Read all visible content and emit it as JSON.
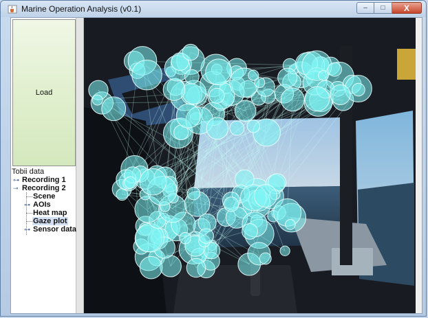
{
  "window": {
    "title": "Marine Operation Analysis (v0.1)",
    "close_glyph": "X",
    "min_glyph": "–",
    "max_glyph": "□"
  },
  "left_panel": {
    "load_label": "Load",
    "tree": {
      "root": "Tobii data",
      "recording1": "Recording 1",
      "recording2": "Recording 2",
      "children": [
        "Scene",
        "AOIs",
        "Heat map",
        "Gaze plot",
        "Sensor data"
      ],
      "selected": "Gaze plot"
    }
  },
  "colors": {
    "fixation_fill": "#7ff4f4",
    "fixation_stroke": "#e8ffff",
    "saccade_line": "#c6fff7",
    "window_frame": "#c2d5ea",
    "load_button": "#e1f0cf",
    "selection": "#d3dff2"
  },
  "icons": {
    "app": "java-cup-icon",
    "tree_handle": "key-handle-icon",
    "close": "close-icon"
  }
}
